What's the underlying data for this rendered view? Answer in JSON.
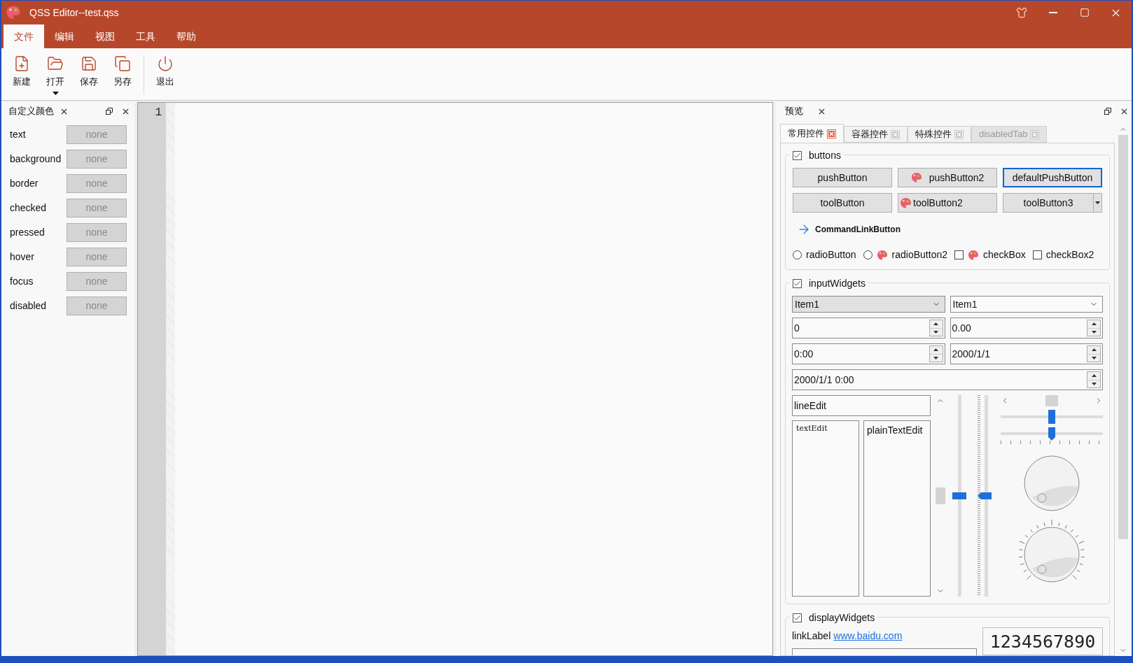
{
  "window": {
    "title": "QSS Editor--test.qss"
  },
  "menu": [
    {
      "label": "文件",
      "selected": true
    },
    {
      "label": "编辑",
      "selected": false
    },
    {
      "label": "视图",
      "selected": false
    },
    {
      "label": "工具",
      "selected": false
    },
    {
      "label": "帮助",
      "selected": false
    }
  ],
  "toolbar": [
    {
      "label": "新建",
      "kind": "new",
      "dropdown": false
    },
    {
      "label": "打开",
      "kind": "open",
      "dropdown": true
    },
    {
      "label": "保存",
      "kind": "save",
      "dropdown": false
    },
    {
      "label": "另存",
      "kind": "save_as",
      "dropdown": false
    },
    {
      "label": "退出",
      "kind": "exit",
      "dropdown": false
    }
  ],
  "color_panel": {
    "title": "自定义颜色",
    "rows": [
      {
        "label": "text",
        "value": "none"
      },
      {
        "label": "background",
        "value": "none"
      },
      {
        "label": "border",
        "value": "none"
      },
      {
        "label": "checked",
        "value": "none"
      },
      {
        "label": "pressed",
        "value": "none"
      },
      {
        "label": "hover",
        "value": "none"
      },
      {
        "label": "focus",
        "value": "none"
      },
      {
        "label": "disabled",
        "value": "none"
      }
    ]
  },
  "editor": {
    "line_numbers": [
      "1"
    ]
  },
  "preview": {
    "title": "预览",
    "tabs": [
      {
        "label": "常用控件",
        "selected": true,
        "disabled": false
      },
      {
        "label": "容器控件",
        "selected": false,
        "disabled": false
      },
      {
        "label": "特殊控件",
        "selected": false,
        "disabled": false
      },
      {
        "label": "disabledTab",
        "selected": false,
        "disabled": true
      }
    ],
    "buttons_group": {
      "title": "buttons",
      "checked": true,
      "buttons": [
        {
          "label": "pushButton",
          "kind": "push",
          "default": false
        },
        {
          "label": "pushButton2",
          "kind": "push",
          "icon": true,
          "default": false
        },
        {
          "label": "defaultPushButton",
          "kind": "push",
          "default": true
        },
        {
          "label": "toolButton",
          "kind": "tool",
          "default": false
        },
        {
          "label": "toolButton2",
          "kind": "tool",
          "icon": true,
          "default": false
        },
        {
          "label": "toolButton3",
          "kind": "menu_tool",
          "default": false
        }
      ],
      "command_link": "CommandLinkButton",
      "toggles": [
        {
          "kind": "radio",
          "label": "radioButton",
          "checked": false
        },
        {
          "kind": "radio",
          "label": "radioButton2",
          "icon": true,
          "checked": false
        },
        {
          "kind": "checkbox",
          "label": "checkBox",
          "icon": true,
          "checked": false
        },
        {
          "kind": "checkbox",
          "label": "checkBox2",
          "checked": false
        }
      ]
    },
    "input_group": {
      "title": "inputWidgets",
      "checked": true,
      "combos": [
        {
          "value": "Item1",
          "editable": false
        },
        {
          "value": "Item1",
          "editable": true
        }
      ],
      "spin_boxes": [
        "0",
        "0.00",
        "0:00",
        "2000/1/1"
      ],
      "date_time": "2000/1/1 0:00",
      "line_edit": "lineEdit",
      "text_edit": "textEdit",
      "plain_text_edit": "plainTextEdit",
      "vertical_scrollbar": {
        "level": 0.5
      },
      "vertical_slider": {
        "level": 0.5
      },
      "vertical_ticked_slider": {
        "level": 0.5
      },
      "horizontal_scrollbar": {
        "level": 0.5
      },
      "horizontal_slider": {
        "level": 0.5
      },
      "horizontal_ticked_slider": {
        "level": 0.5
      }
    },
    "display_group": {
      "title": "displayWidgets",
      "checked": true,
      "link_label": "linkLabel",
      "link": "www.baidu.com",
      "lcd": "1234567890"
    }
  }
}
